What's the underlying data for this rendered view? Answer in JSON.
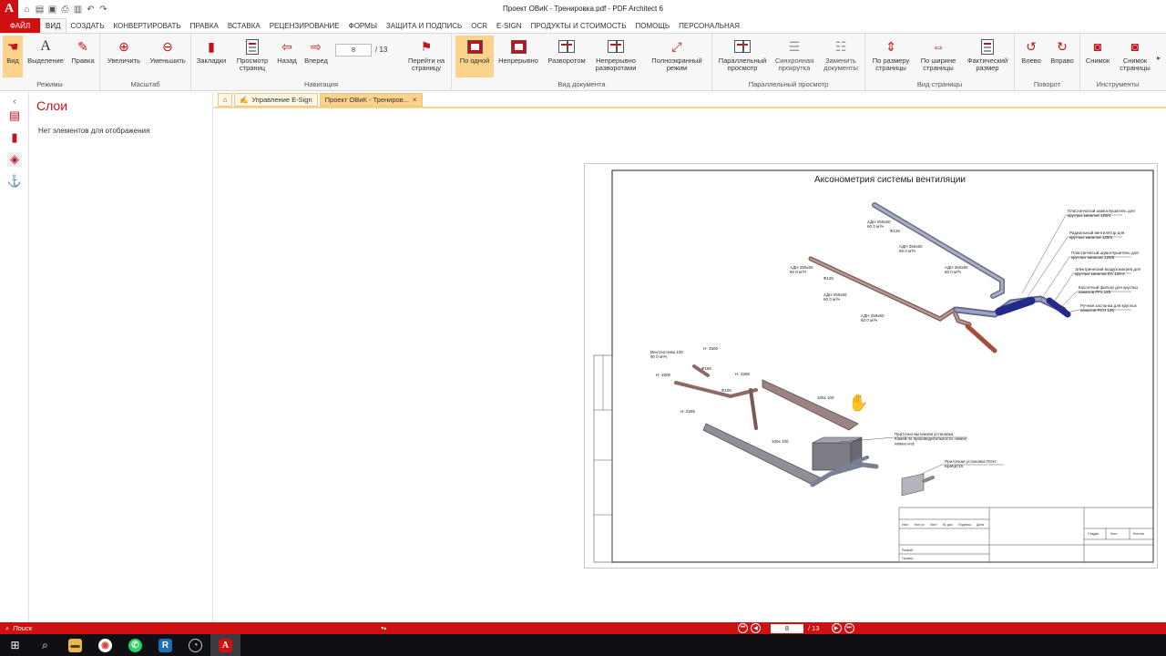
{
  "window": {
    "title": "Проект ОВиК - Тренировка.pdf    -    PDF Architect 6"
  },
  "menu": {
    "file": "ФАЙЛ",
    "tabs": [
      "ВИД",
      "СОЗДАТЬ",
      "КОНВЕРТИРОВАТЬ",
      "ПРАВКА",
      "ВСТАВКА",
      "РЕЦЕНЗИРОВАНИЕ",
      "ФОРМЫ",
      "ЗАЩИТА И ПОДПИСЬ",
      "OCR",
      "E-SIGN",
      "ПРОДУКТЫ И СТОИМОСТЬ",
      "ПОМОЩЬ",
      "ПЕРСОНАЛЬНАЯ"
    ]
  },
  "ribbon": {
    "modes": {
      "label": "Режимы",
      "view": "Вид",
      "select": "Выделение",
      "edit": "Правка"
    },
    "zoom": {
      "label": "Масштаб",
      "in": "Увеличить",
      "out": "Уменьшить"
    },
    "navigation": {
      "label": "Навигация",
      "bookmarks": "Закладки",
      "preview": "Просмотр\nстраниц",
      "back": "Назад",
      "forward": "Вперед",
      "page": "8",
      "total": "/   13",
      "goto": "Перейти на\nстраницу"
    },
    "docview": {
      "label": "Вид документа",
      "single": "По одной",
      "continuous": "Непрерывно",
      "spread": "Разворотом",
      "cont_spread": "Непрерывно\nразворотами",
      "fullscreen": "Полноэкранный\nрежим"
    },
    "parallel": {
      "label": "Параллельный просмотр",
      "parallel": "Параллельный\nпросмотр",
      "sync": "Синхронная\nпрокрутка",
      "replace": "Заменить\nдокументы"
    },
    "pageview": {
      "label": "Вид страницы",
      "fit_page": "По размеру\nстраницы",
      "fit_width": "По ширине\nстраницы",
      "actual": "Фактический\nразмер"
    },
    "rotate": {
      "label": "Поворот",
      "left": "Влево",
      "right": "Вправо"
    },
    "tools": {
      "label": "Инструменты",
      "snapshot": "Снимок",
      "page_snapshot": "Снимок\nстраницы"
    }
  },
  "panel": {
    "title": "Слои",
    "empty": "Нет элементов для отображения"
  },
  "doctabs": [
    {
      "label": "Управление E-Sign"
    },
    {
      "label": "Проект ОВиК - Трениров...",
      "close": "×"
    }
  ],
  "drawing": {
    "title": "Аксонометрия системы вентиляции",
    "callouts": [
      "Пластинчатый шумоглушитель для\nкруглых каналов 125/4",
      "Радиальный вентилятор для\nкруглых каналов 125/1",
      "Пластинчатый шумоглушитель для\nкруглых каналов 125/5",
      "Электрический воздухонагрев для\nкруглых каналов ЕА 125-2",
      "Кассетный фильтр для круглых\nканалов FF1 125",
      "Ручная заслонка для круглых\nканалов RCH 125"
    ],
    "labels": [
      "АДН 250х60\n60 0 м³/ч",
      "Ф125",
      "АДН 250х60\n60 0 м³/ч",
      "АДН 250х60\n60 0 м³/ч",
      "АДН 250х60\n60 0 м³/ч",
      "Ф125",
      "АДН 250х60\n60 0 м³/ч",
      "АДН 250х60\n60 0 м³/ч",
      "Вентсистема 100\n90 0 м³/ч",
      "Н- 2500",
      "Н- 2500",
      "Н- 2285",
      "Н- 2285",
      "Ф160",
      "Ф100",
      "100х 100",
      "100х 100",
      "Приточно-вытяжная установка\nКомей по производительности -нижно\nнижне-нта",
      "Приточная установка ПОН\nБрандт15"
    ],
    "stamp": [
      "Изм",
      "Кол уч",
      "Лист",
      "№ док",
      "Подпись",
      "Дата",
      "Стадия",
      "Лист",
      "Листов",
      "Разраб",
      "Провер"
    ]
  },
  "status": {
    "search_placeholder": "Поиск",
    "page": "8",
    "total": "/ 13"
  }
}
